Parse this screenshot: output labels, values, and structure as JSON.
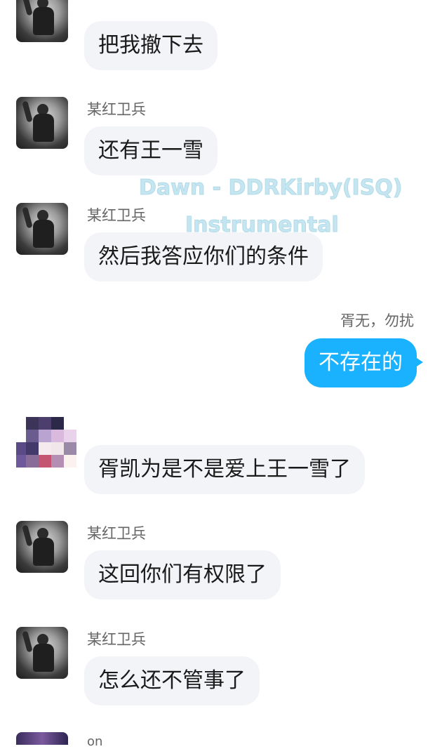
{
  "watermark": {
    "line1": "Dawn - DDRKirby(ISQ)",
    "line2": "Instrumental"
  },
  "messages": [
    {
      "sender": "",
      "text": "把我撤下去"
    },
    {
      "sender": "某红卫兵",
      "text": "还有王一雪"
    },
    {
      "sender": "某红卫兵",
      "text": "然后我答应你们的条件"
    },
    {
      "sender": "胥无，勿扰",
      "text": "不存在的",
      "self": true
    },
    {
      "sender": "",
      "text": "胥凯为是不是爱上王一雪了"
    },
    {
      "sender": "某红卫兵",
      "text": "这回你们有权限了"
    },
    {
      "sender": "某红卫兵",
      "text": "怎么还不管事了"
    },
    {
      "sender": "on",
      "text": ""
    }
  ],
  "colors": {
    "self_bubble": "#1ab2ff",
    "other_bubble": "#f3f4f8",
    "name_text": "#666666"
  }
}
